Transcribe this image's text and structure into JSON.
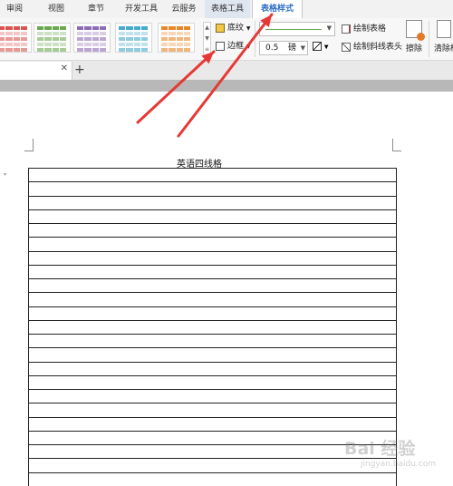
{
  "menu_tabs": [
    {
      "id": "review",
      "label": "审阅"
    },
    {
      "id": "view",
      "label": "视图"
    },
    {
      "id": "section",
      "label": "章节"
    },
    {
      "id": "developer",
      "label": "开发工具"
    },
    {
      "id": "cloud",
      "label": "云服务"
    },
    {
      "id": "table_tools",
      "label": "表格工具"
    },
    {
      "id": "table_style",
      "label": "表格样式"
    }
  ],
  "active_tab": "表格样式",
  "ribbon": {
    "shading_label": "底纹",
    "border_label": "边框",
    "line_width_value": "0.5",
    "line_width_unit": "磅",
    "draw_table_label": "绘制表格",
    "draw_diagonal_label": "绘制斜线表头",
    "erase_label": "擦除",
    "clear_label": "清除样"
  },
  "style_swatch_colors": [
    "#d9534f",
    "#6aa84f",
    "#8e6bb5",
    "#45a9c9",
    "#e8862a"
  ],
  "line_style_color": "#6aa84f",
  "document": {
    "title": "英语四线格",
    "row_count": 23
  },
  "watermark": {
    "text": "Bai 经验",
    "sub": "jingyan.baidu.com"
  },
  "annotation_color": "#e53935"
}
